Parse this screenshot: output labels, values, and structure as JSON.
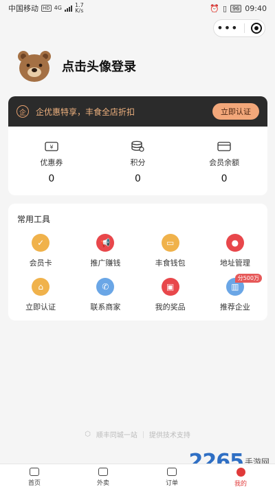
{
  "status_bar": {
    "carrier": "中国移动",
    "hd": "HD",
    "network": "4G",
    "speed_value": "1.7",
    "speed_unit": "K/s",
    "battery": "96",
    "time": "09:40"
  },
  "capsule": {
    "more_icon": "more-dots-icon",
    "close_icon": "target-icon"
  },
  "profile": {
    "login_text": "点击头像登录"
  },
  "vip": {
    "icon_text": "企",
    "promo_text": "企优惠特享，丰食全店折扣",
    "button_label": "立即认证"
  },
  "assets": [
    {
      "icon": "coupon-icon",
      "label": "优惠券",
      "value": "0"
    },
    {
      "icon": "points-icon",
      "label": "积分",
      "value": "0"
    },
    {
      "icon": "wallet-card-icon",
      "label": "会员余额",
      "value": "0"
    }
  ],
  "tools": {
    "title": "常用工具",
    "items": [
      {
        "label": "会员卡",
        "icon": "member-card-icon",
        "color": "#f0b24b"
      },
      {
        "label": "推广赚钱",
        "icon": "megaphone-icon",
        "color": "#e8474b"
      },
      {
        "label": "丰食钱包",
        "icon": "wallet-icon",
        "color": "#f0b24b"
      },
      {
        "label": "地址管理",
        "icon": "location-icon",
        "color": "#e8474b"
      },
      {
        "label": "立即认证",
        "icon": "store-icon",
        "color": "#f0b24b"
      },
      {
        "label": "联系商家",
        "icon": "phone-icon",
        "color": "#6aa6e6"
      },
      {
        "label": "我的奖品",
        "icon": "gift-icon",
        "color": "#e8474b"
      },
      {
        "label": "推荐企业",
        "icon": "building-icon",
        "color": "#6aa6e6",
        "badge": "分500万"
      }
    ]
  },
  "footer": {
    "brand": "顺丰同城一站",
    "support": "提供技术支持"
  },
  "watermark": {
    "number": "2265",
    "text": "手游网"
  },
  "tabbar": [
    {
      "label": "首页",
      "icon": "home-icon"
    },
    {
      "label": "外卖",
      "icon": "takeout-icon"
    },
    {
      "label": "订单",
      "icon": "order-icon"
    },
    {
      "label": "我的",
      "icon": "profile-icon",
      "active": true
    }
  ],
  "colors": {
    "accent": "#e03a3a",
    "vip_bg": "#2b2b2b",
    "vip_gold": "#f2a77a"
  }
}
